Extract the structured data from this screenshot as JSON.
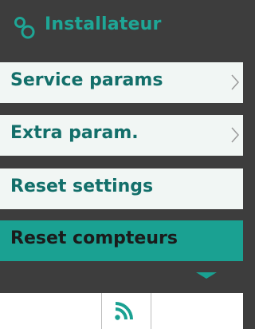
{
  "header": {
    "title": "Installateur",
    "icon": "settings-gears-icon"
  },
  "menu": {
    "items": [
      {
        "label": "Service params",
        "has_submenu": true,
        "selected": false
      },
      {
        "label": "Extra param.",
        "has_submenu": true,
        "selected": false
      },
      {
        "label": "Reset settings",
        "has_submenu": false,
        "selected": false
      },
      {
        "label": "Reset compteurs",
        "has_submenu": false,
        "selected": true
      }
    ],
    "scroll_indicator": "scroll-down-arrow-icon"
  },
  "bottom_bar": {
    "center_icon": "rss-feed-icon"
  },
  "colors": {
    "accent": "#1ea696",
    "selected_bg": "#1aa192",
    "item_bg": "#f1f6f4",
    "item_text": "#136f6a",
    "background": "#3d3d3d"
  }
}
